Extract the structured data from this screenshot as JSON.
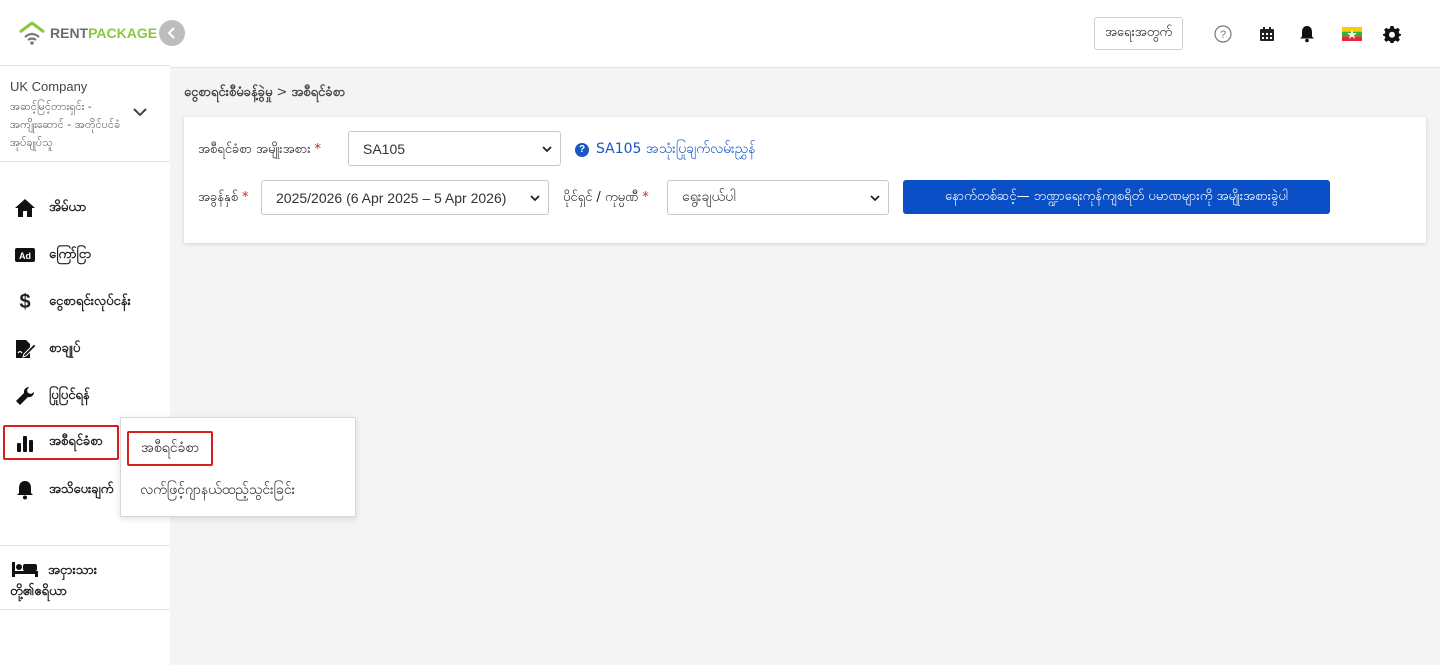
{
  "brand": {
    "rent": "RENT",
    "package": "PACKAGE"
  },
  "company": {
    "name": "UK Company",
    "description": "အဆင့်မြင့်တားရှင်း - အကျိုးဆောင် - အတိုင်ပင်ခံအုပ်ချုပ်သူ"
  },
  "sidebar": {
    "items": [
      {
        "label": "အိမ်ယာ",
        "icon": "home-icon"
      },
      {
        "label": "ကြော်ငြာ",
        "icon": "ad-icon"
      },
      {
        "label": "ငွေစာရင်းလုပ်ငန်း",
        "icon": "dollar-icon"
      },
      {
        "label": "စာချုပ်",
        "icon": "contract-sign-icon"
      },
      {
        "label": "ပြုပြင်ရန်",
        "icon": "wrench-icon"
      },
      {
        "label": "အစီရင်ခံစာ",
        "icon": "bar-chart-icon"
      },
      {
        "label": "အသိပေးချက်",
        "icon": "bell-icon"
      }
    ],
    "guest": {
      "label_line1": "အငှားသား",
      "label_line2": "တို့၏ဧရိယာ",
      "icon": "bed-icon"
    }
  },
  "header": {
    "help_label": "အရေးအတွက်",
    "icons": [
      "question-circle-icon",
      "calendar-icon",
      "bell-icon",
      "myanmar-flag-icon",
      "gear-icon"
    ]
  },
  "breadcrumb": {
    "parent": "ငွေစာရင်းစီမံခန့်ခွဲမှု",
    "separator": ">",
    "current": "အစီရင်ခံစာ"
  },
  "form": {
    "report_type": {
      "label": "အစီရင်ခံစာ အမျိုးအစား",
      "value": "SA105"
    },
    "info_link": "SA105 အသုံးပြုချက်လမ်းညွှန်",
    "tax_year": {
      "label": "အခွန်နှစ်",
      "value": "2025/2026 (6 Apr 2025 – 5 Apr 2026)"
    },
    "owner": {
      "label": "ပိုင်ရှင် / ကုမ္ပဏီ",
      "value": "ရွေးချယ်ပါ"
    },
    "required_mark": "*",
    "submit_label": "နောက်တစ်ဆင့်— ဘဏ္ဍာရေးကုန်ကျစရိတ် ပမာဏများကို အမျိုးအစားခွဲပါ"
  },
  "popup": {
    "items": [
      "အစီရင်ခံစာ",
      "လက်ဖြင့်ဂျာနယ်ထည့်သွင်းခြင်း"
    ]
  },
  "colors": {
    "brand_green": "#8cc63f",
    "primary_blue": "#0b4fc7",
    "highlight_red": "#d6211f",
    "link_blue": "#1a56c4"
  }
}
